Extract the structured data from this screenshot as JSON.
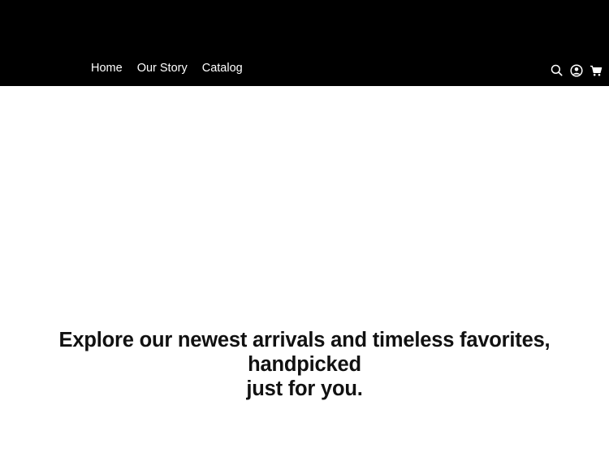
{
  "header": {
    "background": "#000000",
    "nav_items": [
      {
        "label": "Home"
      },
      {
        "label": "Our Story"
      },
      {
        "label": "Catalog"
      }
    ],
    "icons": [
      "search-icon",
      "account-icon",
      "cart-icon"
    ]
  },
  "hero": {
    "tagline_line1": "Explore our newest arrivals and timeless favorites, handpicked",
    "tagline_line2": "just for you."
  }
}
